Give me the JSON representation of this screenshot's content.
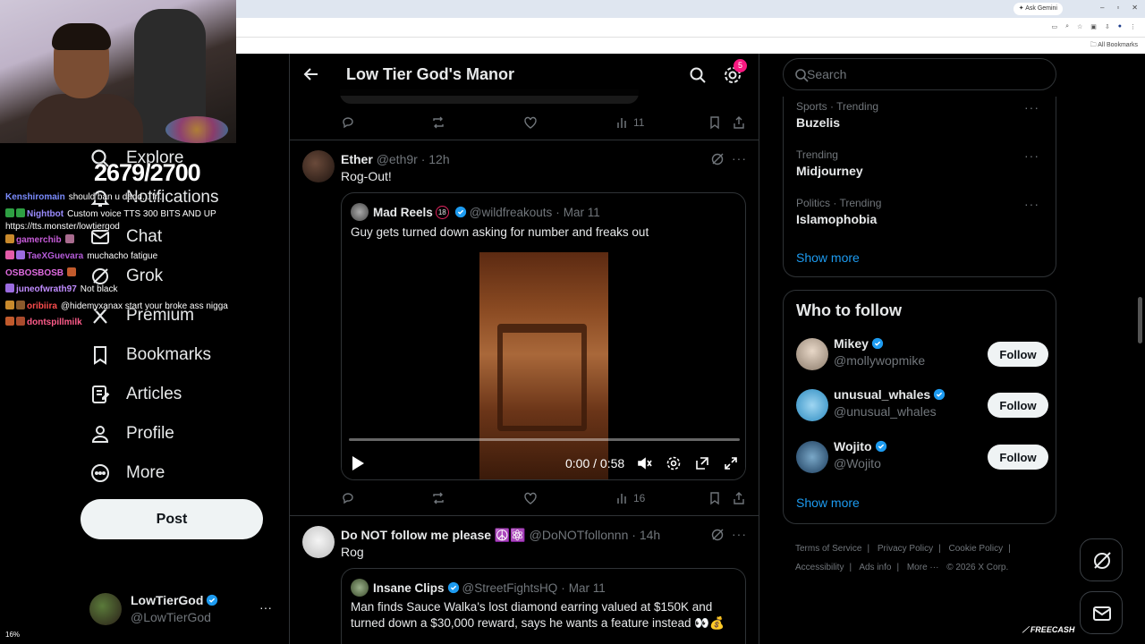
{
  "browser": {
    "ask_label": "✦ Ask Gemini",
    "all_bookmarks": "All Bookmarks",
    "window_controls": [
      "–",
      "▫",
      "✕"
    ]
  },
  "stream": {
    "counter": "2679/2700",
    "bits_label": "16%",
    "chat": [
      {
        "user": "Kenshiromain",
        "color": "#7b8cff",
        "msg": "should ban u dadd... fr...",
        "badges": []
      },
      {
        "user": "Nightbot",
        "color": "#9b8cff",
        "msg": "Custom voice TTS 300 BITS AND UP",
        "badges": [
          "#2ea043",
          "#2ea043"
        ]
      },
      {
        "user": "",
        "color": "#fff",
        "msg": "https://tts.monster/lowtiergod",
        "badges": []
      },
      {
        "user": "gamerchib",
        "color": "#c65bd8",
        "msg": "",
        "badges": [
          "#c98a2c",
          "#a86b8e"
        ]
      },
      {
        "user": "TaeXGuevara",
        "color": "#b45bd8",
        "msg": "muchacho fatigue",
        "badges": [
          "#e45ba8",
          "#9b6be0"
        ]
      },
      {
        "user": "OSBOSBOSB",
        "color": "#e06be0",
        "msg": "",
        "badges": [
          "#c15a2c"
        ]
      },
      {
        "user": "juneofwrath97",
        "color": "#c08cff",
        "msg": "Not black",
        "badges": [
          "#9b6be0"
        ]
      },
      {
        "user": "oribiira",
        "color": "#ff4d4d",
        "msg": "@hidemyxanax start your broke ass nigga",
        "badges": [
          "#c98a2c",
          "#8a5a2c"
        ]
      },
      {
        "user": "dontspillmilk",
        "color": "#ff5c8a",
        "msg": "",
        "badges": [
          "#c15a2c",
          "#a84a2c"
        ]
      }
    ]
  },
  "nav": {
    "items": [
      {
        "label": "Explore",
        "icon": "search-icon"
      },
      {
        "label": "Notifications",
        "icon": "bell-icon"
      },
      {
        "label": "Chat",
        "icon": "mail-icon"
      },
      {
        "label": "Grok",
        "icon": "grok-icon"
      },
      {
        "label": "Premium",
        "icon": "x-logo-icon"
      },
      {
        "label": "Bookmarks",
        "icon": "bookmark-icon"
      },
      {
        "label": "Articles",
        "icon": "article-icon"
      },
      {
        "label": "Profile",
        "icon": "person-icon"
      },
      {
        "label": "More",
        "icon": "more-circle-icon"
      }
    ],
    "post_label": "Post",
    "account": {
      "name": "LowTierGod",
      "handle": "@LowTierGod",
      "more": "···"
    }
  },
  "header": {
    "title": "Low Tier God's Manor",
    "notifications_count": "5"
  },
  "feed": {
    "prev_actions": {
      "views": "11"
    },
    "tweets": [
      {
        "name": "Ether",
        "handle": "@eth9r",
        "time": "12h",
        "text": "Rog-Out!",
        "avatar_color": "#3a2a22",
        "quote": {
          "name": "Mad Reels",
          "age_badge": "18",
          "handle": "@wildfreakouts",
          "date": "Mar 11",
          "text": "Guy gets turned down asking for number and freaks out",
          "video": {
            "time": "0:00 / 0:58",
            "progress": 0
          }
        },
        "views": "16"
      },
      {
        "name": "Do NOT follow me please ☮️⚛️",
        "handle": "@DoNOTfollonnn",
        "time": "14h",
        "text": "Rog",
        "avatar_color": "#ddd",
        "quote": {
          "name": "Insane Clips",
          "handle": "@StreetFightsHQ",
          "date": "Mar 11",
          "text": "Man finds Sauce Walka's lost diamond earring valued at $150K and turned down a $30,000 reward, says he wants a feature instead 👀💰"
        }
      }
    ]
  },
  "sidebar": {
    "search_placeholder": "Search",
    "trends": [
      {
        "category": "Sports · Trending",
        "name": "Buzelis"
      },
      {
        "category": "Trending",
        "name": "Midjourney"
      },
      {
        "category": "Politics · Trending",
        "name": "Islamophobia"
      }
    ],
    "show_more": "Show more",
    "who_to_follow_title": "Who to follow",
    "follow_label": "Follow",
    "suggestions": [
      {
        "name": "Mikey",
        "handle": "@mollywopmike",
        "avatar_color": "#c9b8a8"
      },
      {
        "name": "unusual_whales",
        "handle": "@unusual_whales",
        "avatar_color": "#5fb2e0"
      },
      {
        "name": "Wojito",
        "handle": "@Wojito",
        "avatar_color": "#3a6a8a"
      }
    ],
    "footer_links": [
      "Terms of Service",
      "Privacy Policy",
      "Cookie Policy",
      "Accessibility",
      "Ads info",
      "More ···"
    ],
    "copyright": "© 2026 X Corp."
  },
  "overlay": {
    "freecash": "FREECASH"
  }
}
